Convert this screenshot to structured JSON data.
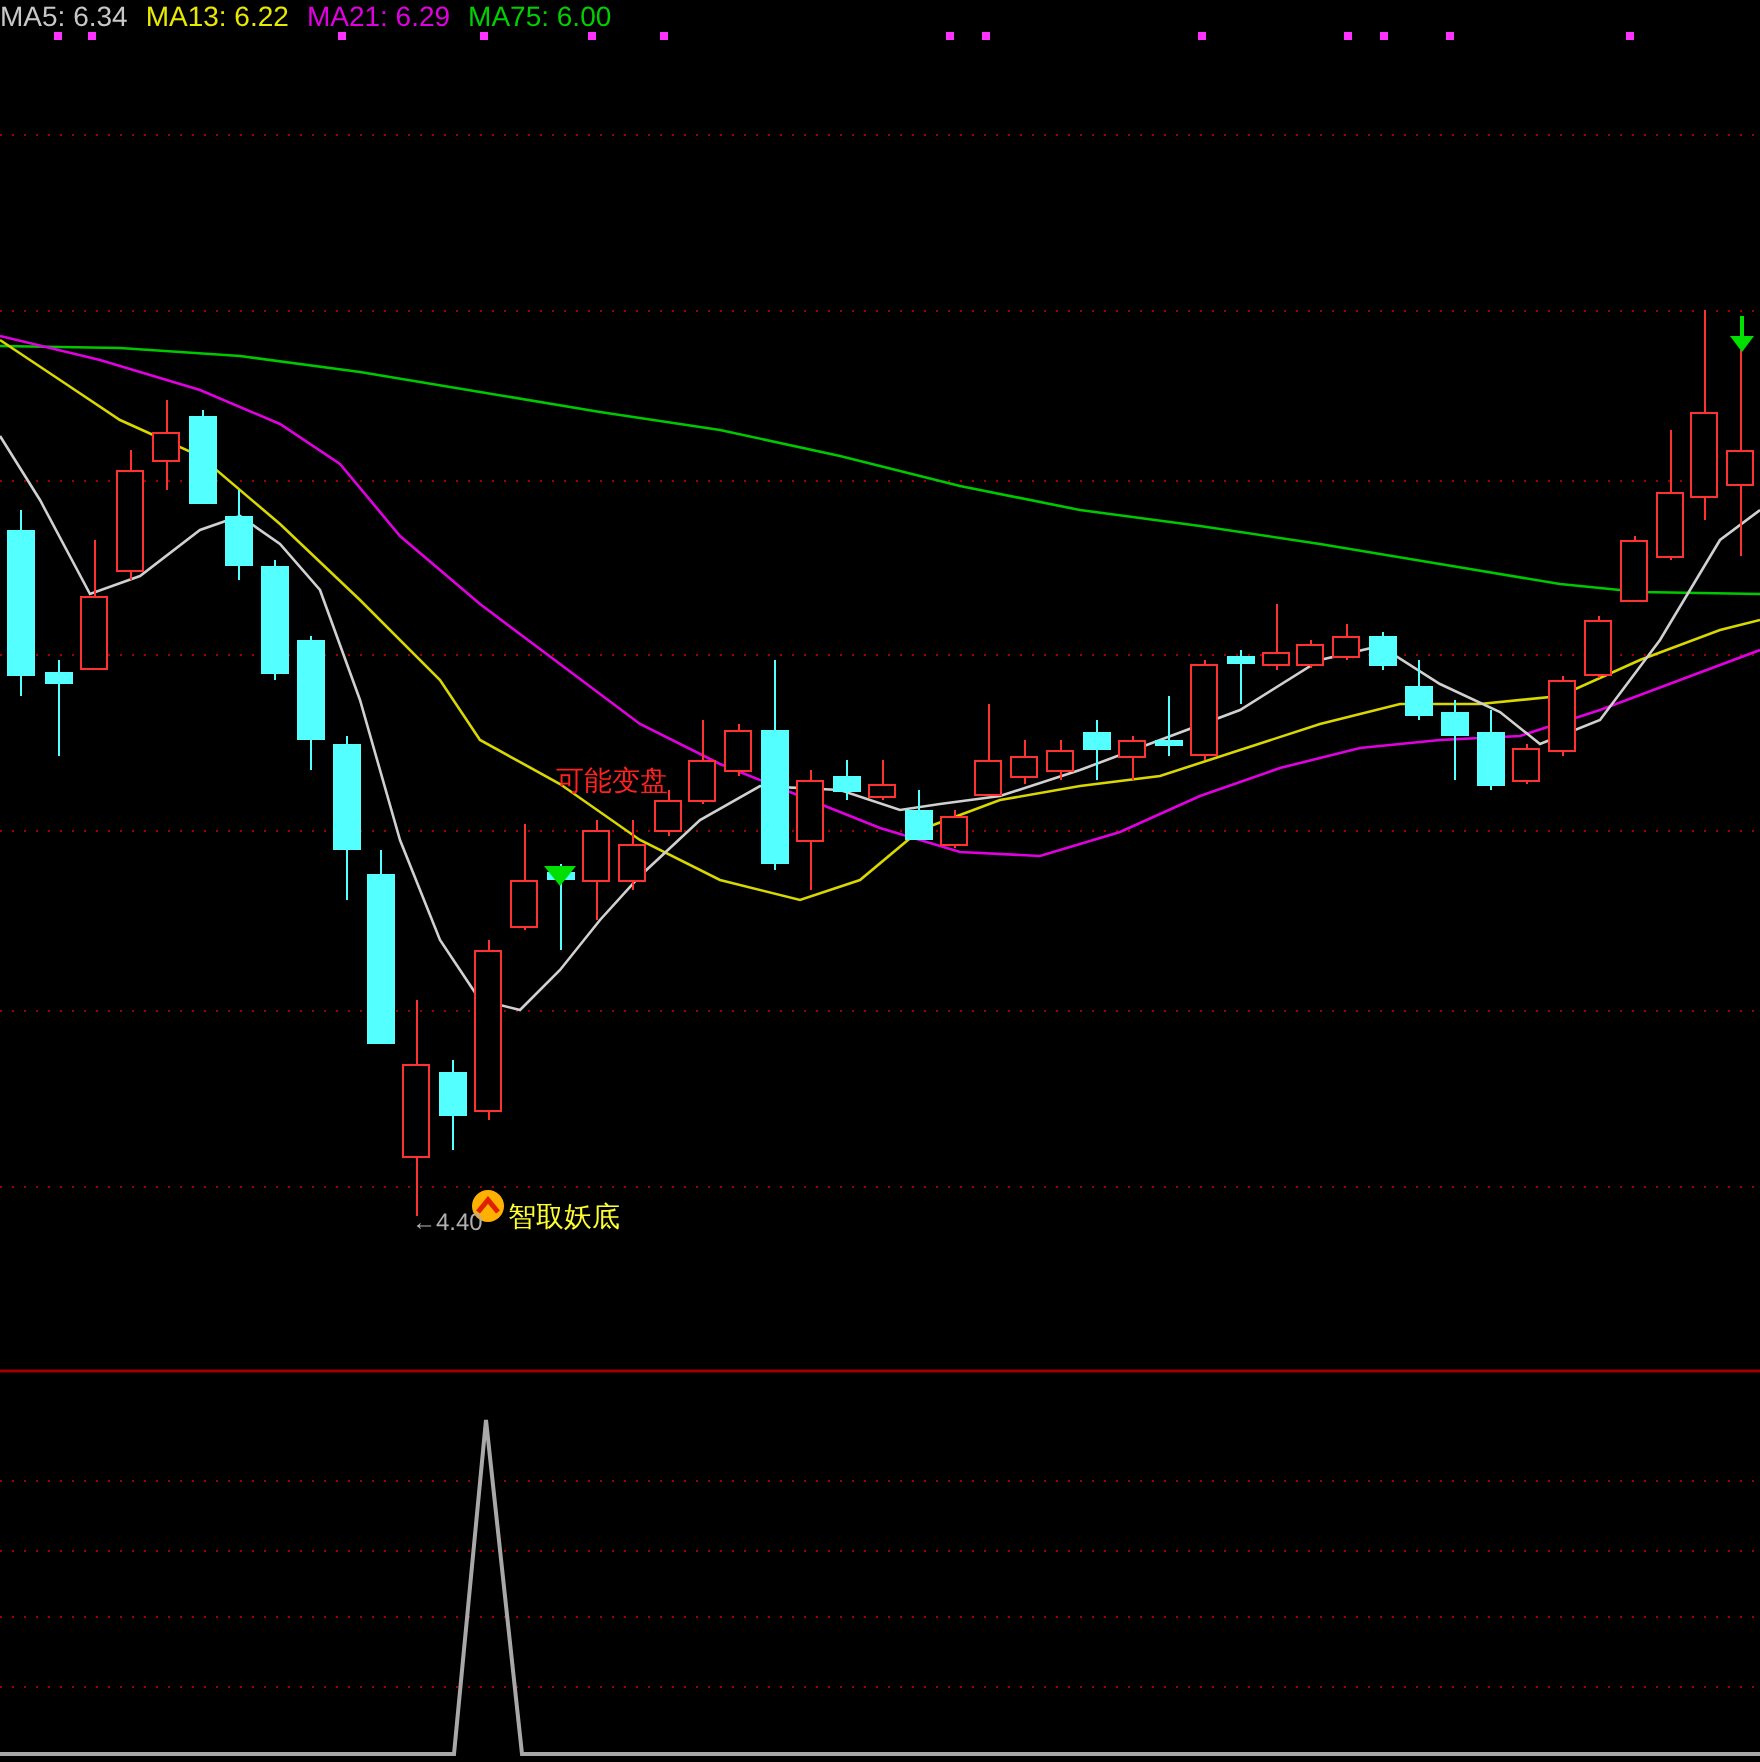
{
  "legend": [
    {
      "label": "MA5: 6.34",
      "color": "#c8c8c8"
    },
    {
      "label": "MA13: 6.22",
      "color": "#e8e800"
    },
    {
      "label": "MA21: 6.29",
      "color": "#e000e0"
    },
    {
      "label": "MA75: 6.00",
      "color": "#00d000"
    }
  ],
  "annotations": [
    {
      "kind": "warning",
      "text": "可能变盘"
    },
    {
      "kind": "low_price",
      "text": "←4.40"
    },
    {
      "kind": "bottom_signal",
      "text": "智取妖底"
    }
  ]
}
